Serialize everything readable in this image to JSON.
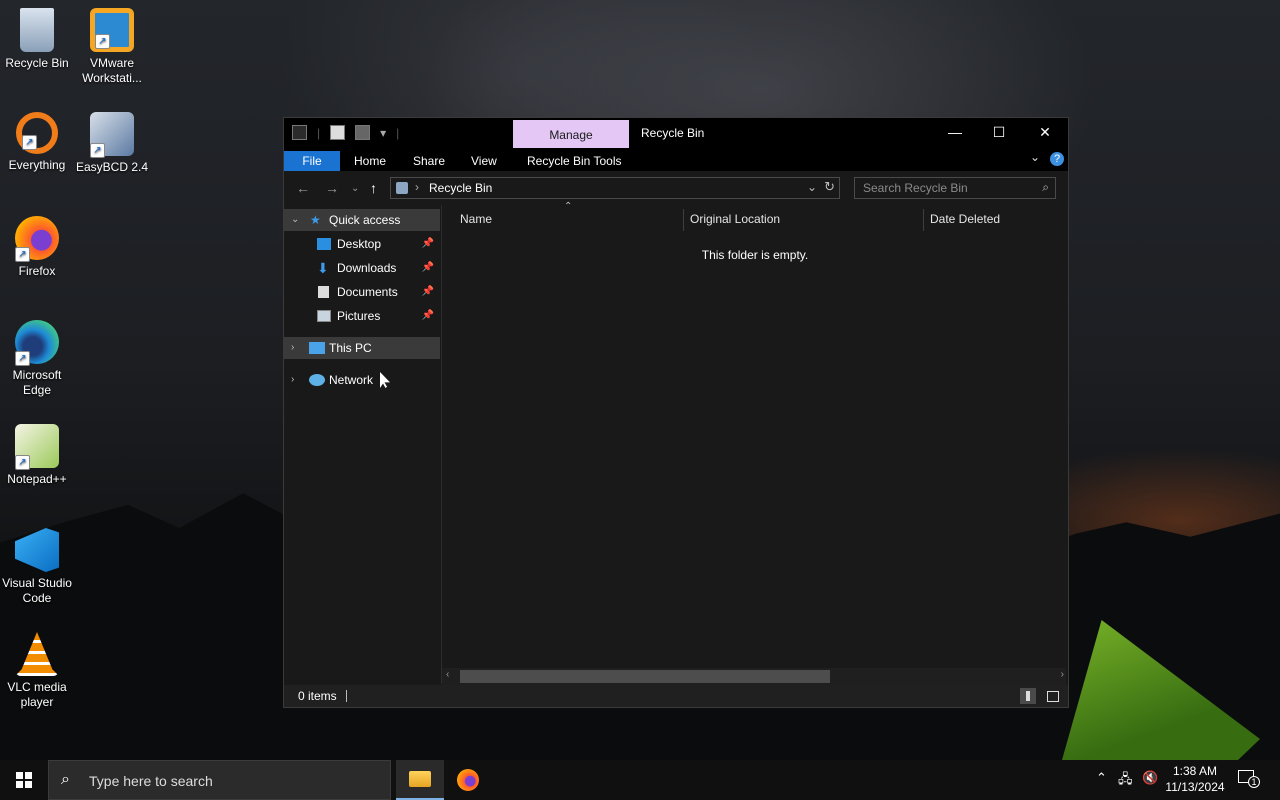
{
  "desktop": {
    "icons": [
      {
        "label": "Recycle Bin",
        "icon": "recycle-bin-icon"
      },
      {
        "label": "VMware Workstati...",
        "icon": "vmware-icon"
      },
      {
        "label": "Everything",
        "icon": "everything-icon"
      },
      {
        "label": "EasyBCD 2.4",
        "icon": "easybcd-icon"
      },
      {
        "label": "Firefox",
        "icon": "firefox-icon"
      },
      {
        "label": "Microsoft Edge",
        "icon": "edge-icon"
      },
      {
        "label": "Notepad++",
        "icon": "notepadpp-icon"
      },
      {
        "label": "Visual Studio Code",
        "icon": "vscode-icon"
      },
      {
        "label": "VLC media player",
        "icon": "vlc-icon"
      }
    ]
  },
  "window": {
    "title": "Recycle Bin",
    "contextual_tab": "Manage",
    "ribbon_tabs": {
      "file": "File",
      "home": "Home",
      "share": "Share",
      "view": "View",
      "tools": "Recycle Bin Tools"
    },
    "address": {
      "path": "Recycle Bin",
      "search_placeholder": "Search Recycle Bin"
    },
    "nav_pane": {
      "quick_access": "Quick access",
      "desktop": "Desktop",
      "downloads": "Downloads",
      "documents": "Documents",
      "pictures": "Pictures",
      "this_pc": "This PC",
      "network": "Network"
    },
    "columns": {
      "name": "Name",
      "original_location": "Original Location",
      "date_deleted": "Date Deleted"
    },
    "empty_message": "This folder is empty.",
    "status": {
      "items": "0 items"
    }
  },
  "taskbar": {
    "search_placeholder": "Type here to search",
    "time": "1:38 AM",
    "date": "11/13/2024",
    "notification_count": "1"
  },
  "colors": {
    "accent": "#1a73d1",
    "manage_tab": "#e4c7f5",
    "window_bg": "#191919",
    "selected_nav": "#3a3a3a"
  }
}
